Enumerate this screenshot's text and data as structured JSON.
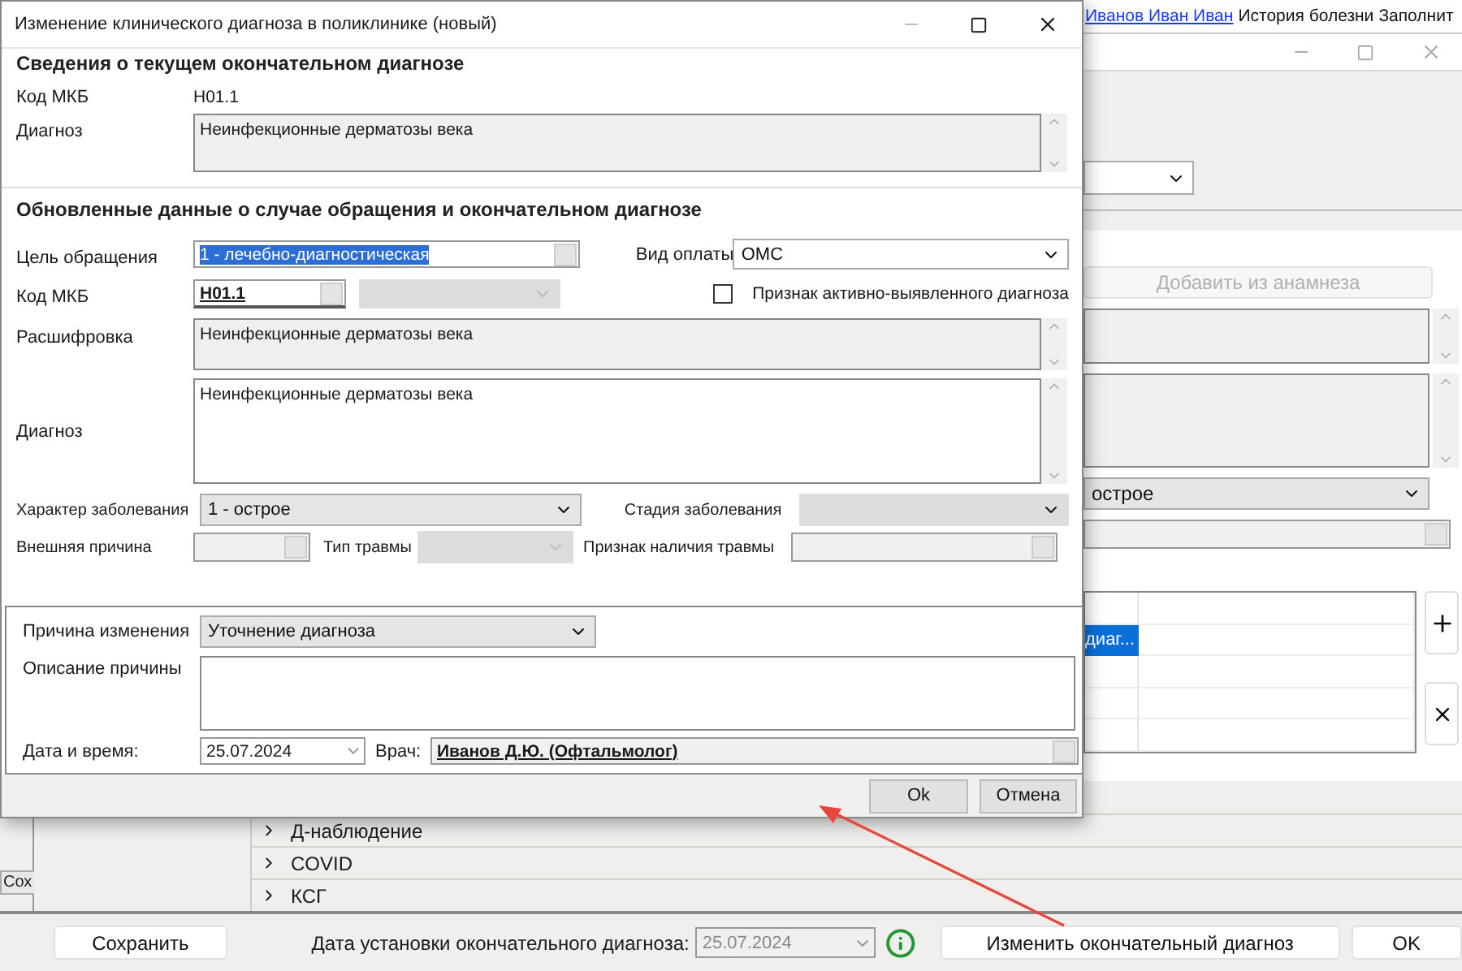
{
  "background": {
    "menu": [
      {
        "label": "Иванов Иван Иван",
        "kind": "link"
      },
      {
        "label": "История болезни",
        "kind": "tab"
      },
      {
        "label": "Заполнит",
        "kind": "tab"
      }
    ],
    "add_button": {
      "label": "Добавить из анамнеза",
      "disabled": true
    },
    "character_select": {
      "value": "острое"
    },
    "table": {
      "cell": {
        "text": "диаг...",
        "selected": true
      }
    },
    "sections": [
      {
        "label": "Д-наблюдение"
      },
      {
        "label": "COVID"
      },
      {
        "label": "КСГ"
      }
    ],
    "left_tab": "Сох",
    "footer": {
      "save": "Сохранить",
      "date_label": "Дата установки окончательного диагноза:",
      "date_value": "25.07.2024",
      "change": "Изменить окончательный диагноз",
      "ok": "OK"
    }
  },
  "dialog": {
    "title": "Изменение клинического диагноза в поликлинике (новый)",
    "current": {
      "heading": "Сведения о текущем окончательном диагнозе",
      "icd_label": "Код МКБ",
      "icd_value": "H01.1",
      "diagnosis_label": "Диагноз",
      "diagnosis_value": "Неинфекционные дерматозы века"
    },
    "updated": {
      "heading": "Обновленные данные о случае обращения и окончательном диагнозе",
      "purpose": {
        "label": "Цель обращения",
        "value": "1 - лечебно-диагностическая",
        "highlighted": true
      },
      "payment": {
        "label": "Вид оплаты",
        "value": "ОМС"
      },
      "icd": {
        "label": "Код МКБ",
        "value": "H01.1"
      },
      "active_flag": {
        "label": "Признак активно-выявленного диагноза",
        "checked": false
      },
      "decoding": {
        "label": "Расшифровка",
        "value": "Неинфекционные дерматозы века"
      },
      "diagnosis": {
        "label": "Диагноз",
        "value": "Неинфекционные дерматозы века"
      },
      "character": {
        "label": "Характер заболевания",
        "value": "1 - острое"
      },
      "stage": {
        "label": "Стадия заболевания",
        "disabled": true
      },
      "external_cause": {
        "label": "Внешняя причина",
        "disabled": true
      },
      "injury_type": {
        "label": "Тип травмы",
        "disabled": true
      },
      "injury_flag": {
        "label": "Признак наличия травмы",
        "disabled": true
      }
    },
    "change": {
      "reason": {
        "label": "Причина изменения",
        "value": "Уточнение диагноза"
      },
      "description": {
        "label": "Описание причины"
      },
      "datetime": {
        "label": "Дата и время:",
        "value": "25.07.2024"
      },
      "doctor": {
        "label": "Врач:",
        "value": "Иванов Д.Ю. (Офтальмолог)"
      }
    },
    "buttons": [
      {
        "label": "Ok"
      },
      {
        "label": "Отмена"
      }
    ]
  }
}
